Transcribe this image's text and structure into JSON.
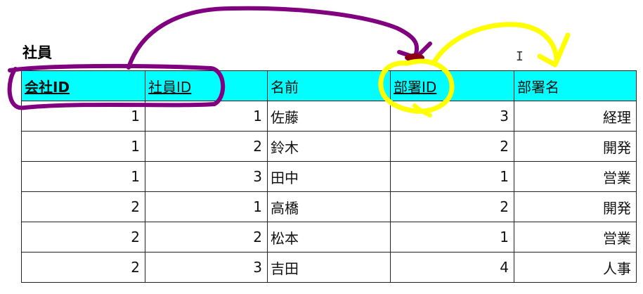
{
  "title": "社員",
  "columns": [
    {
      "label": "会社ID",
      "key": true,
      "bold": true,
      "align": "right"
    },
    {
      "label": "社員ID",
      "key": true,
      "bold": false,
      "align": "right"
    },
    {
      "label": "名前",
      "key": false,
      "bold": false,
      "align": "left"
    },
    {
      "label": "部署ID",
      "key": true,
      "bold": false,
      "align": "right"
    },
    {
      "label": "部署名",
      "key": false,
      "bold": false,
      "align": "right"
    }
  ],
  "rows": [
    [
      "1",
      "1",
      "佐藤",
      "3",
      "経理"
    ],
    [
      "1",
      "2",
      "鈴木",
      "2",
      "開発"
    ],
    [
      "1",
      "3",
      "田中",
      "1",
      "営業"
    ],
    [
      "2",
      "1",
      "高橋",
      "2",
      "開発"
    ],
    [
      "2",
      "2",
      "松本",
      "1",
      "営業"
    ],
    [
      "2",
      "3",
      "吉田",
      "4",
      "人事"
    ]
  ],
  "colors": {
    "header_bg": "#00ffff",
    "purple_annotation": "#800080",
    "yellow_annotation": "#ffff00"
  },
  "icons": {
    "cursor": "i-beam-cursor-icon"
  }
}
